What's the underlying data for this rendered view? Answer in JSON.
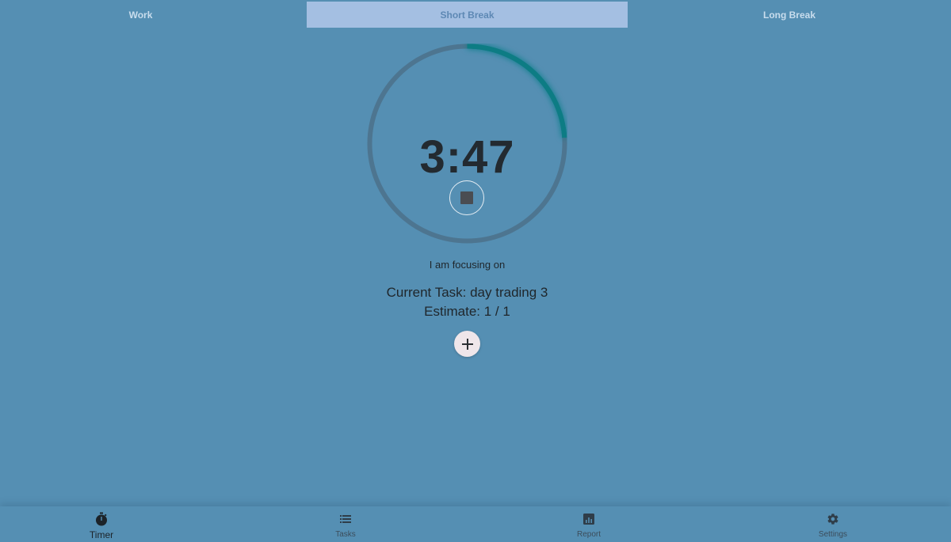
{
  "tabs": [
    {
      "label": "Work",
      "active": false
    },
    {
      "label": "Short Break",
      "active": true
    },
    {
      "label": "Long Break",
      "active": false
    }
  ],
  "timer": {
    "time": "3:47",
    "progress": 0.24,
    "progress_color": "#0a7c84",
    "track_color": "#4d7590",
    "stop_icon": "stop-icon"
  },
  "focus": {
    "label": "I am focusing on",
    "current_task": "Current Task: day trading 3",
    "estimate": "Estimate: 1 / 1",
    "add_icon": "plus-icon"
  },
  "bottom_nav": [
    {
      "label": "Timer",
      "icon": "stopwatch-icon",
      "active": true
    },
    {
      "label": "Tasks",
      "icon": "list-icon",
      "active": false
    },
    {
      "label": "Report",
      "icon": "bar-chart-icon",
      "active": false
    },
    {
      "label": "Settings",
      "icon": "gear-icon",
      "active": false
    }
  ],
  "colors": {
    "background": "#558fb3",
    "active_tab": "#a4bfe2"
  }
}
